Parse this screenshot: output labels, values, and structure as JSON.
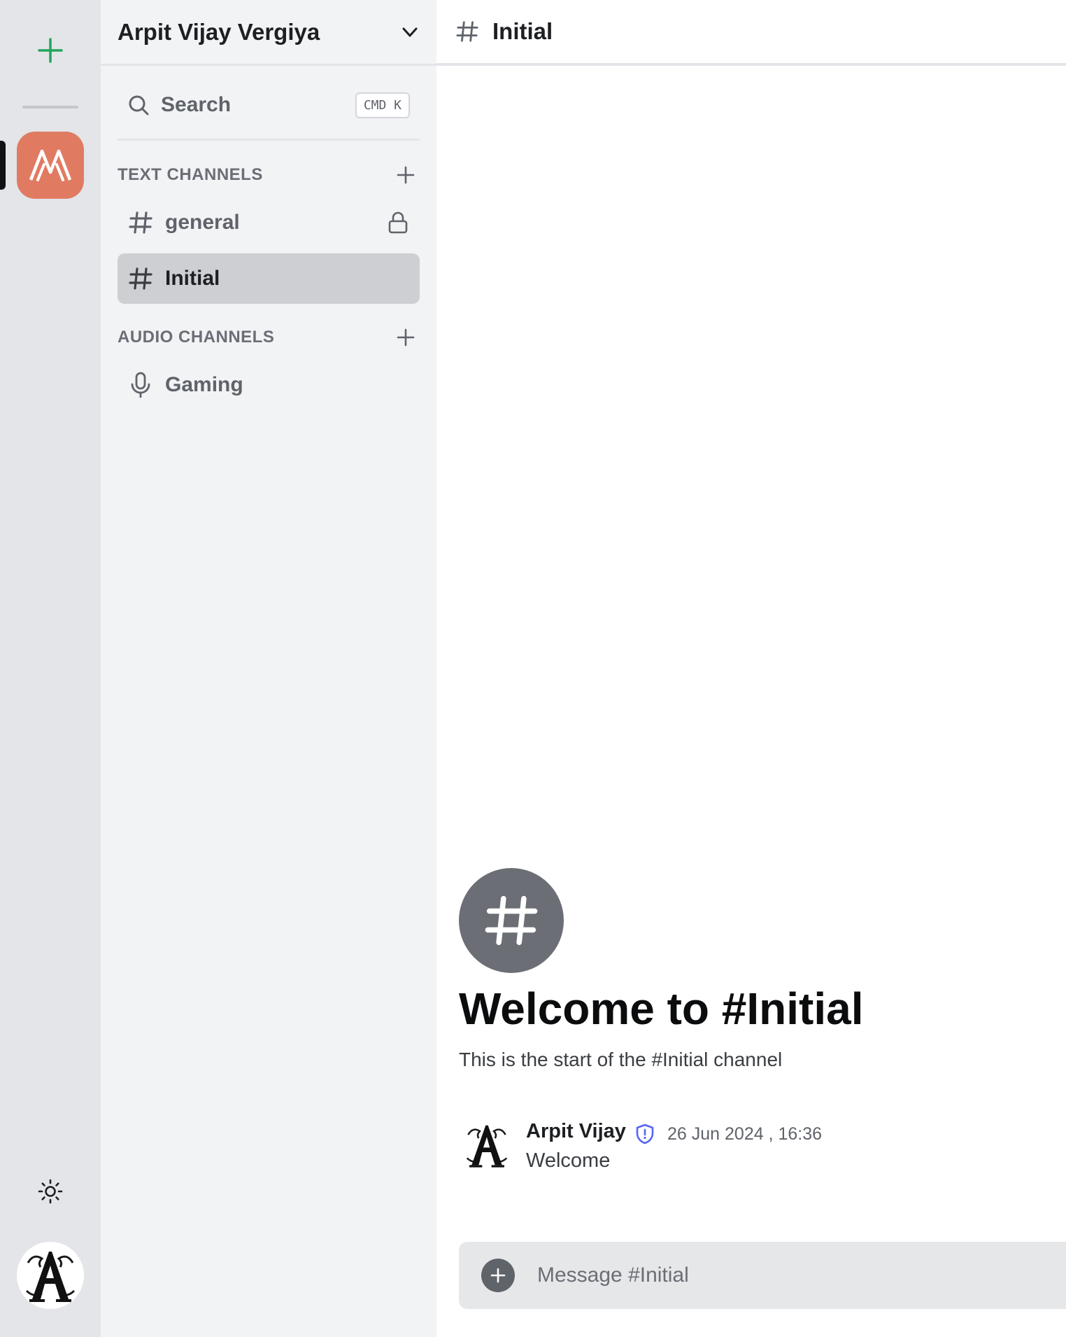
{
  "rail": {
    "add_server_icon": "plus-icon",
    "server_initials": "AV",
    "server_color": "#e07b62",
    "accent_green": "#23a55a",
    "theme_icon": "sun-icon"
  },
  "sidebar": {
    "server_name": "Arpit Vijay Vergiya",
    "search_label": "Search",
    "search_shortcut": "CMD K",
    "text_section": "TEXT CHANNELS",
    "audio_section": "AUDIO CHANNELS",
    "text_channels": [
      {
        "name": "general",
        "locked": true,
        "active": false
      },
      {
        "name": "Initial",
        "locked": false,
        "active": true
      }
    ],
    "audio_channels": [
      {
        "name": "Gaming"
      }
    ]
  },
  "main": {
    "channel_title": "Initial",
    "welcome_title": "Welcome to #Initial",
    "welcome_subtitle": "This is the start of the #Initial channel",
    "messages": [
      {
        "author": "Arpit Vijay",
        "badge": "shield-alert-icon",
        "timestamp": "26 Jun 2024 , 16:36",
        "content": "Welcome"
      }
    ],
    "composer_placeholder": "Message #Initial"
  }
}
